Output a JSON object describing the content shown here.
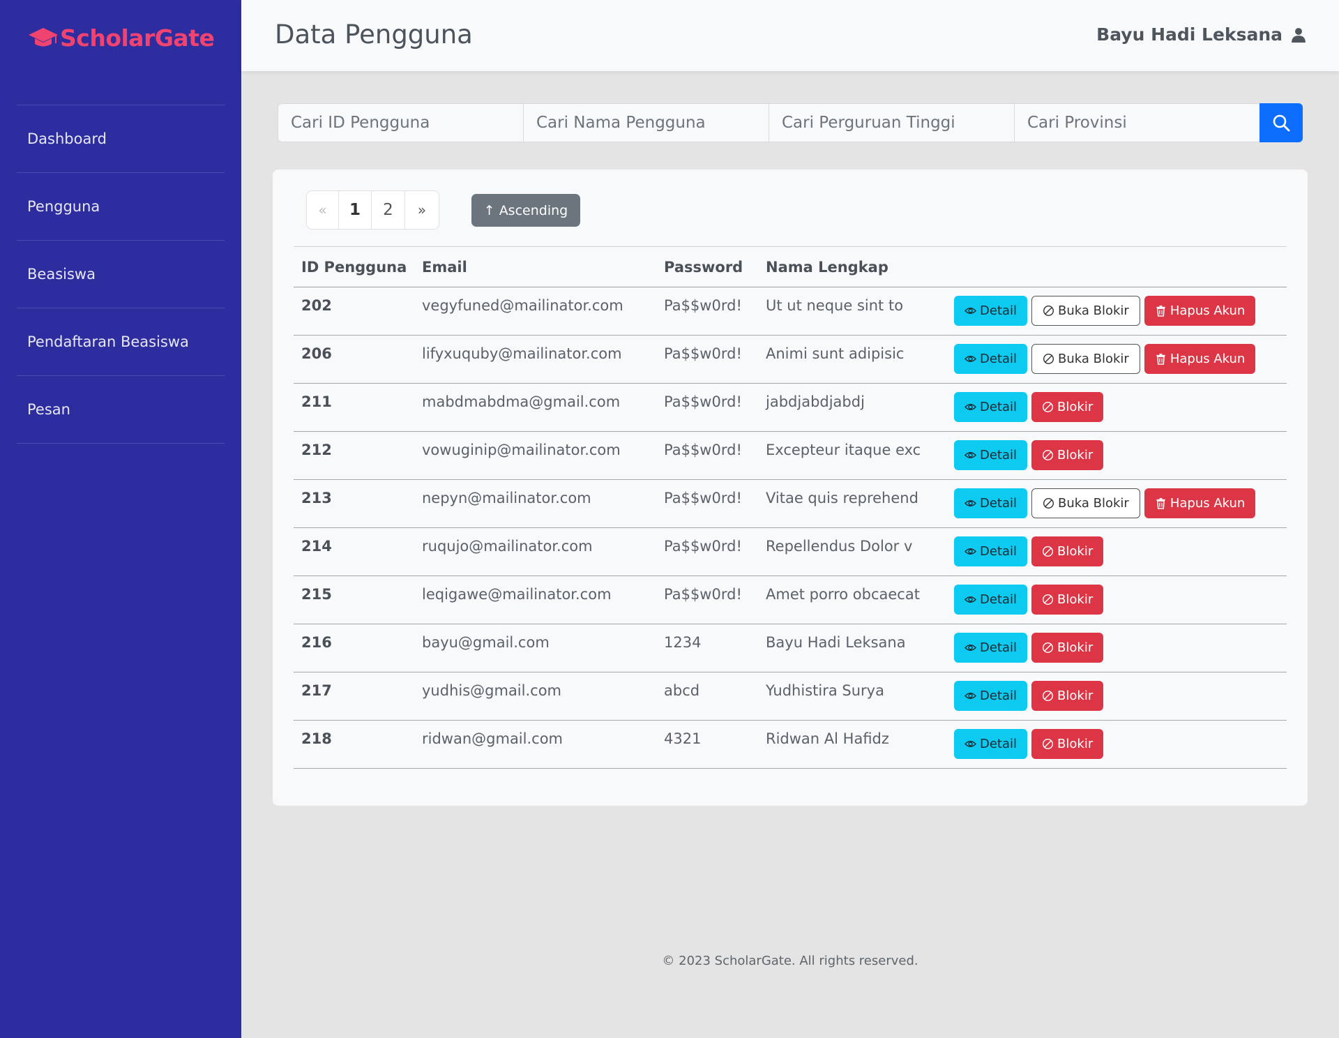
{
  "brand": {
    "name": "ScholarGate",
    "color": "#f0436f"
  },
  "sidebar": {
    "items": [
      {
        "label": "Dashboard"
      },
      {
        "label": "Pengguna"
      },
      {
        "label": "Beasiswa"
      },
      {
        "label": "Pendaftaran Beasiswa"
      },
      {
        "label": "Pesan"
      }
    ]
  },
  "header": {
    "title": "Data Pengguna",
    "user_name": "Bayu Hadi Leksana",
    "user_icon": "user-icon"
  },
  "search": {
    "id_placeholder": "Cari ID Pengguna",
    "name_placeholder": "Cari Nama Pengguna",
    "university_placeholder": "Cari Perguruan Tinggi",
    "province_placeholder": "Cari Provinsi",
    "button_icon": "search-icon"
  },
  "pagination": {
    "prev": "«",
    "page1": "1",
    "page2": "2",
    "next": "»",
    "current": "1"
  },
  "sort": {
    "label": "Ascending"
  },
  "table": {
    "headers": {
      "id": "ID Pengguna",
      "email": "Email",
      "password": "Password",
      "name": "Nama Lengkap"
    },
    "buttons": {
      "detail": "Detail",
      "block": "Blokir",
      "unblock": "Buka Blokir",
      "delete": "Hapus Akun"
    },
    "rows": [
      {
        "id": "202",
        "email": "vegyfuned@mailinator.com",
        "password": "Pa$$w0rd!",
        "name": "Ut ut neque sint to",
        "blocked": true
      },
      {
        "id": "206",
        "email": "lifyxuquby@mailinator.com",
        "password": "Pa$$w0rd!",
        "name": "Animi sunt adipisic",
        "blocked": true
      },
      {
        "id": "211",
        "email": "mabdmabdma@gmail.com",
        "password": "Pa$$w0rd!",
        "name": "jabdjabdjabdj",
        "blocked": false
      },
      {
        "id": "212",
        "email": "vowuginip@mailinator.com",
        "password": "Pa$$w0rd!",
        "name": "Excepteur itaque exc",
        "blocked": false
      },
      {
        "id": "213",
        "email": "nepyn@mailinator.com",
        "password": "Pa$$w0rd!",
        "name": "Vitae quis reprehend",
        "blocked": true
      },
      {
        "id": "214",
        "email": "ruqujo@mailinator.com",
        "password": "Pa$$w0rd!",
        "name": "Repellendus Dolor v",
        "blocked": false
      },
      {
        "id": "215",
        "email": "leqigawe@mailinator.com",
        "password": "Pa$$w0rd!",
        "name": "Amet porro obcaecat",
        "blocked": false
      },
      {
        "id": "216",
        "email": "bayu@gmail.com",
        "password": "1234",
        "name": "Bayu Hadi Leksana",
        "blocked": false
      },
      {
        "id": "217",
        "email": "yudhis@gmail.com",
        "password": "abcd",
        "name": "Yudhistira Surya",
        "blocked": false
      },
      {
        "id": "218",
        "email": "ridwan@gmail.com",
        "password": "4321",
        "name": "Ridwan Al Hafidz",
        "blocked": false
      }
    ]
  },
  "footer": {
    "text": "© 2023 ScholarGate. All rights reserved."
  },
  "colors": {
    "sidebar": "#2e2da0",
    "primary": "#0d6efd",
    "info": "#0dcaf0",
    "danger": "#dc3545",
    "secondary": "#6c757d"
  }
}
